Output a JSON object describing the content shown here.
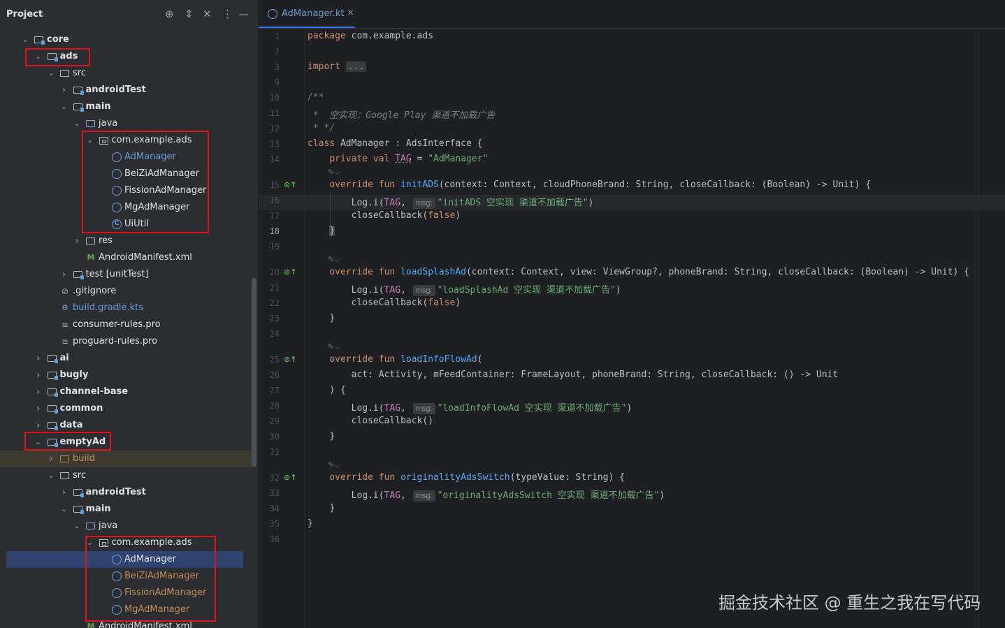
{
  "panel": {
    "title": "Project",
    "icons": [
      "crosshair-icon",
      "expand-icon",
      "collapse-icon",
      "more-icon",
      "minimize-icon"
    ]
  },
  "tree": [
    {
      "label": "core",
      "bold": true,
      "kind": "module",
      "chev": "v"
    },
    {
      "label": "ads",
      "bold": true,
      "kind": "module",
      "chev": "v"
    },
    {
      "label": "src",
      "kind": "folder",
      "chev": "v"
    },
    {
      "label": "androidTest",
      "bold": true,
      "kind": "module",
      "chev": ">"
    },
    {
      "label": "main",
      "bold": true,
      "kind": "module",
      "chev": "v"
    },
    {
      "label": "java",
      "kind": "srcfolder",
      "chev": "v"
    },
    {
      "label": "com.example.ads",
      "kind": "package",
      "chev": "v"
    },
    {
      "label": "AdManager",
      "kind": "kclass",
      "color": "blue"
    },
    {
      "label": "BeiZiAdManager",
      "kind": "kclass"
    },
    {
      "label": "FissionAdManager",
      "kind": "kclass"
    },
    {
      "label": "MgAdManager",
      "kind": "kclass"
    },
    {
      "label": "UiUtil",
      "kind": "class"
    },
    {
      "label": "res",
      "kind": "folder",
      "chev": ">"
    },
    {
      "label": "AndroidManifest.xml",
      "kind": "xml"
    },
    {
      "label": "test [unitTest]",
      "kind": "module",
      "chev": ">"
    },
    {
      "label": ".gitignore",
      "kind": "ignore"
    },
    {
      "label": "build.gradle.kts",
      "kind": "gradle",
      "color": "blue"
    },
    {
      "label": "consumer-rules.pro",
      "kind": "file"
    },
    {
      "label": "proguard-rules.pro",
      "kind": "file"
    },
    {
      "label": "ai",
      "bold": true,
      "kind": "module",
      "chev": ">"
    },
    {
      "label": "bugly",
      "bold": true,
      "kind": "module",
      "chev": ">"
    },
    {
      "label": "channel-base",
      "bold": true,
      "kind": "module",
      "chev": ">"
    },
    {
      "label": "common",
      "bold": true,
      "kind": "module",
      "chev": ">"
    },
    {
      "label": "data",
      "bold": true,
      "kind": "module",
      "chev": ">"
    },
    {
      "label": "emptyAd",
      "bold": true,
      "kind": "module",
      "chev": "v"
    },
    {
      "label": "build",
      "kind": "folder",
      "chev": ">",
      "color": "brown"
    },
    {
      "label": "src",
      "kind": "folder",
      "chev": "v"
    },
    {
      "label": "androidTest",
      "bold": true,
      "kind": "module",
      "chev": ">"
    },
    {
      "label": "main",
      "bold": true,
      "kind": "module",
      "chev": "v"
    },
    {
      "label": "java",
      "kind": "srcfolder",
      "chev": "v"
    },
    {
      "label": "com.example.ads",
      "kind": "package",
      "chev": "v"
    },
    {
      "label": "AdManager",
      "kind": "kclass"
    },
    {
      "label": "BeiZiAdManager",
      "kind": "kclass",
      "color": "brown"
    },
    {
      "label": "FissionAdManager",
      "kind": "kclass",
      "color": "brown"
    },
    {
      "label": "MgAdManager",
      "kind": "kclass",
      "color": "brown"
    },
    {
      "label": "AndroidManifest.xml",
      "kind": "xml"
    }
  ],
  "editor": {
    "tab_label": "AdManager.kt",
    "tab_close": "×",
    "line_numbers": [
      "1",
      "2",
      "3",
      "9",
      "10",
      "11",
      "12",
      "13",
      "14",
      "15",
      "16",
      "17",
      "18",
      "19",
      "20",
      "21",
      "22",
      "23",
      "24",
      "25",
      "26",
      "27",
      "28",
      "29",
      "30",
      "31",
      "32",
      "33",
      "34",
      "35",
      "36"
    ],
    "current_line": "18",
    "hint_msg": "msg:",
    "code": {
      "l1": "package com.example.ads",
      "l3_kw": "import",
      "l3_fold": "...",
      "l10": "/**",
      "l11": " *  空实现：Google Play 渠道不加载广告",
      "l12": " * */",
      "l13_kw": "class",
      "l13_rest": " AdManager : AdsInterface {",
      "l14_kw": "private val",
      "l14_name": "TAG",
      "l14_eq": " = ",
      "l14_str": "\"AdManager\"",
      "l15_kw": "override fun",
      "l15_fn": "initADS",
      "l15_rest": "(context: Context, cloudPhoneBrand: String, closeCallback: (Boolean) -> Unit) {",
      "l16_pre": "Log.i(",
      "l16_tag": "TAG",
      "l16_str": "\"initADS 空实现 渠道不加载广告\"",
      "l16_end": ")",
      "l17_pre": "closeCallback(",
      "l17_kw": "false",
      "l17_end": ")",
      "l18": "}",
      "l20_kw": "override fun",
      "l20_fn": "loadSplashAd",
      "l20_rest": "(context: Context, view: ViewGroup?, phoneBrand: String, closeCallback: (Boolean) -> Unit) {",
      "l21_str": "\"loadSplashAd 空实现 渠道不加载广告\"",
      "l25_kw": "override fun",
      "l25_fn": "loadInfoFlowAd",
      "l25_rest": "(",
      "l26": "act: Activity, mFeedContainer: FrameLayout, phoneBrand: String, closeCallback: () -> Unit",
      "l27": ") {",
      "l28_str": "\"loadInfoFlowAd 空实现 渠道不加载广告\"",
      "l29": "closeCallback()",
      "l32_kw": "override fun",
      "l32_fn": "originalityAdsSwitch",
      "l32_rest": "(typeValue: String) {",
      "l33_str": "\"originalityAdsSwitch 空实现 渠道不加载广告\"",
      "close_brace": "}"
    }
  },
  "watermark": "掘金技术社区 @ 重生之我在写代码"
}
